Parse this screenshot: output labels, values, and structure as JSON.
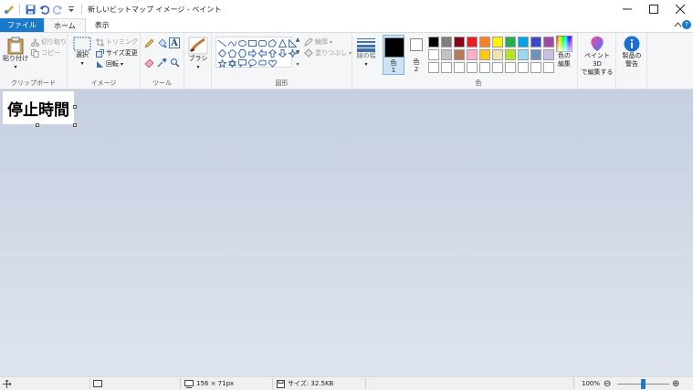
{
  "window": {
    "title": "新しいビットマップ イメージ - ペイント"
  },
  "tabs": [
    {
      "label": "ファイル"
    },
    {
      "label": "ホーム"
    },
    {
      "label": "表示"
    }
  ],
  "ribbon": {
    "clipboard": {
      "label": "クリップボード",
      "paste": "貼り付け",
      "cut": "切り取り",
      "copy": "コピー"
    },
    "image": {
      "label": "イメージ",
      "select": "選択",
      "crop": "トリミング",
      "resize": "サイズ変更",
      "rotate": "回転"
    },
    "tools": {
      "label": "ツール"
    },
    "brush": {
      "label": "ブラシ"
    },
    "shapes": {
      "label": "図形",
      "outline": "輪郭",
      "fill": "塗りつぶし"
    },
    "size": {
      "label": "線の幅"
    },
    "colors": {
      "label": "色",
      "color1": "色\n1",
      "color1_a": "色",
      "color1_b": "1",
      "color2_a": "色",
      "color2_b": "2",
      "edit_a": "色の",
      "edit_b": "編集",
      "color1_value": "#000000",
      "color2_value": "#ffffff",
      "palette": [
        "#000000",
        "#7f7f7f",
        "#880015",
        "#ed1c24",
        "#ff7f27",
        "#fff200",
        "#22b14c",
        "#00a2e8",
        "#3f48cc",
        "#a349a4",
        "#ffffff",
        "#c3c3c3",
        "#b97a57",
        "#ffaec9",
        "#ffc90e",
        "#efe4b0",
        "#b5e61d",
        "#99d9ea",
        "#7092be",
        "#c8bfe7",
        "#ffffff",
        "#ffffff",
        "#ffffff",
        "#ffffff",
        "#ffffff",
        "#ffffff",
        "#ffffff",
        "#ffffff",
        "#ffffff",
        "#ffffff"
      ]
    },
    "paint3d": {
      "line1": "ペイント 3D",
      "line2": "で編集する"
    },
    "product": {
      "line1": "製品の",
      "line2": "警告"
    }
  },
  "canvas": {
    "text": "停止時間"
  },
  "status": {
    "dimensions": "156 × 71px",
    "size": "サイズ: 32.5KB",
    "zoom": "100%",
    "zoom_fraction": 0.5
  }
}
